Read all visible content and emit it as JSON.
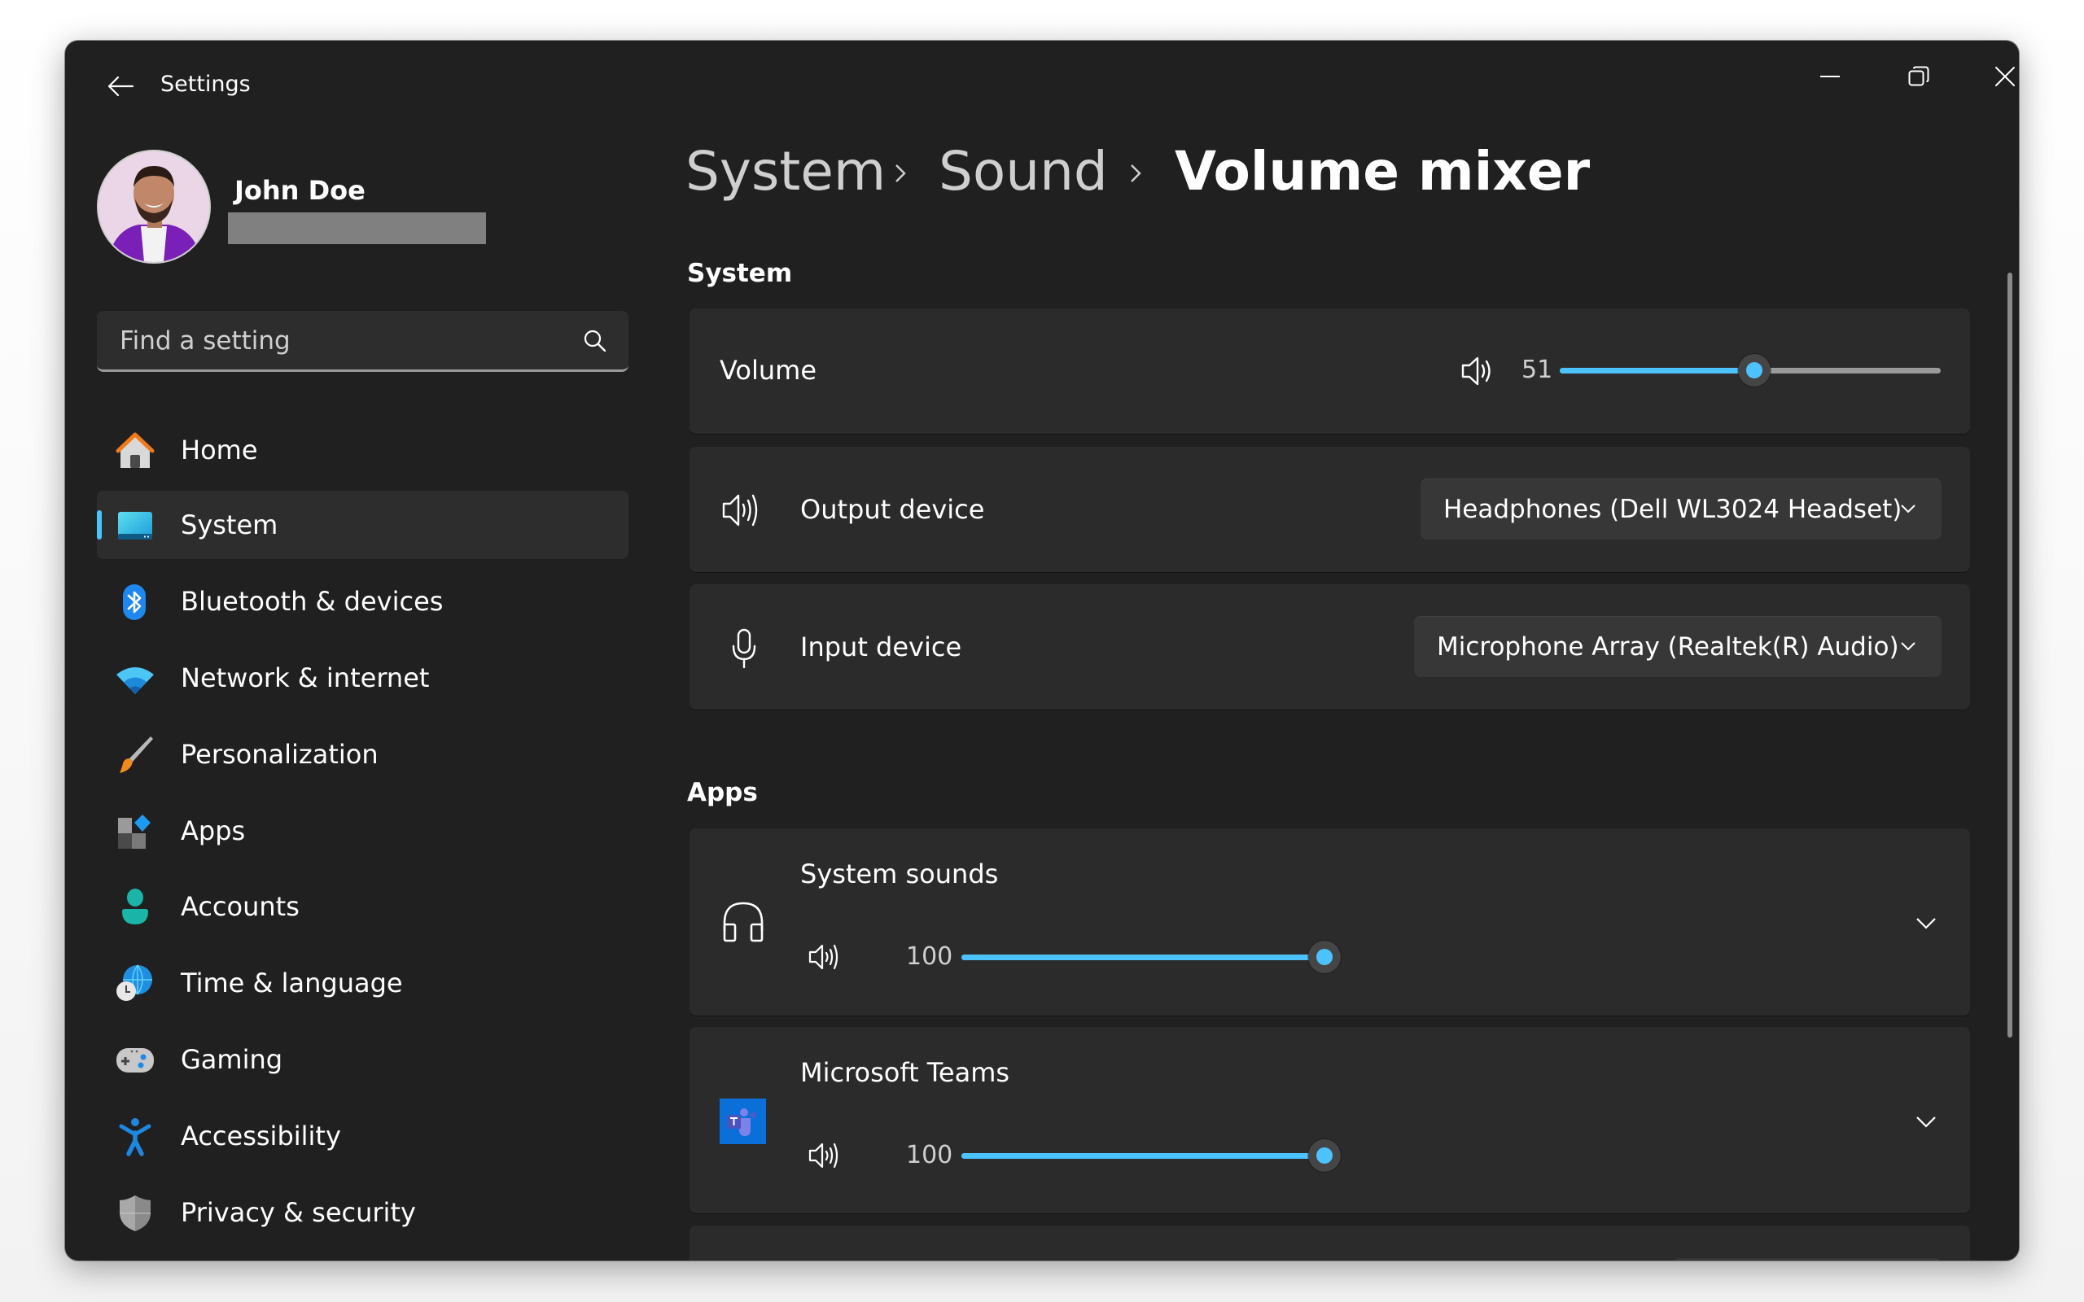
{
  "window": {
    "title": "Settings",
    "controls": {
      "minimize": "minimize-icon",
      "restore": "restore-icon",
      "close": "close-icon"
    }
  },
  "profile": {
    "name": "John Doe",
    "email_redacted": true
  },
  "search": {
    "placeholder": "Find a setting",
    "value": ""
  },
  "sidebar": {
    "items": [
      {
        "label": "Home",
        "icon": "home-icon",
        "active": false
      },
      {
        "label": "System",
        "icon": "system-display-icon",
        "active": true
      },
      {
        "label": "Bluetooth & devices",
        "icon": "bluetooth-icon",
        "active": false
      },
      {
        "label": "Network & internet",
        "icon": "wifi-icon",
        "active": false
      },
      {
        "label": "Personalization",
        "icon": "paintbrush-icon",
        "active": false
      },
      {
        "label": "Apps",
        "icon": "apps-icon",
        "active": false
      },
      {
        "label": "Accounts",
        "icon": "person-icon",
        "active": false
      },
      {
        "label": "Time & language",
        "icon": "globe-clock-icon",
        "active": false
      },
      {
        "label": "Gaming",
        "icon": "gamepad-icon",
        "active": false
      },
      {
        "label": "Accessibility",
        "icon": "accessibility-icon",
        "active": false
      },
      {
        "label": "Privacy & security",
        "icon": "shield-icon",
        "active": false
      }
    ]
  },
  "breadcrumb": {
    "items": [
      "System",
      "Sound",
      "Volume mixer"
    ],
    "separator": "›"
  },
  "system_section": {
    "header": "System",
    "volume": {
      "label": "Volume",
      "value": 51,
      "value_text": "51",
      "icon": "speaker-icon"
    },
    "output_device": {
      "label": "Output device",
      "selected": "Headphones (Dell WL3024 Headset)",
      "icon": "speaker-icon"
    },
    "input_device": {
      "label": "Input device",
      "selected": "Microphone Array (Realtek(R) Audio)",
      "icon": "microphone-icon"
    }
  },
  "apps_section": {
    "header": "Apps",
    "apps": [
      {
        "name": "System sounds",
        "icon": "headphones-icon",
        "volume": 100,
        "volume_text": "100"
      },
      {
        "name": "Microsoft Teams",
        "icon": "teams-icon",
        "volume": 100,
        "volume_text": "100"
      }
    ]
  },
  "colors": {
    "accent": "#4cc2ff",
    "window_bg": "#202020",
    "card_bg": "#2b2b2b",
    "dropdown_bg": "#373737",
    "track": "#9a9a9a"
  }
}
